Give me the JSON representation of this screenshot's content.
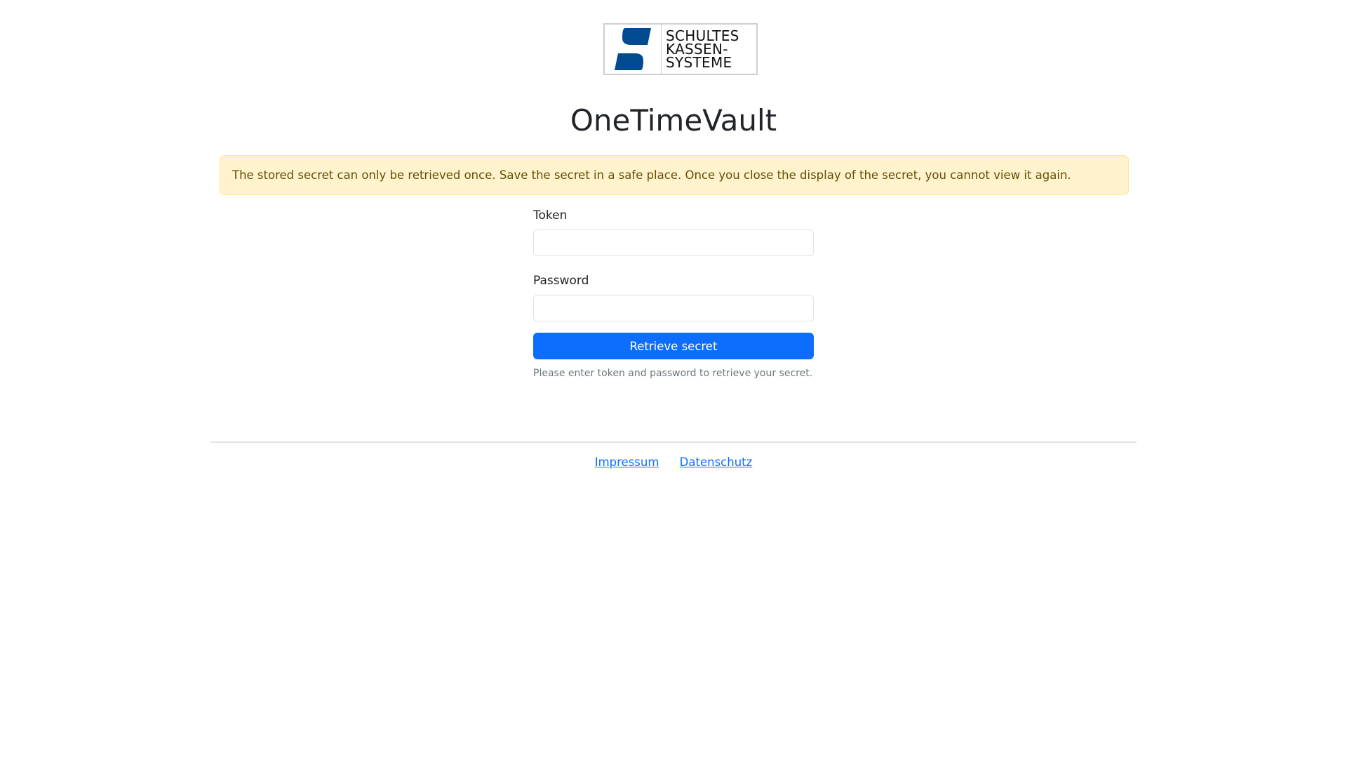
{
  "logo": {
    "line1": "SCHULTES",
    "line2": "KASSEN-",
    "line3": "SYSTEME",
    "mark_color": "#004a8f"
  },
  "page_title": "OneTimeVault",
  "alert": {
    "text": "The stored secret can only be retrieved once. Save the secret in a safe place. Once you close the display of the secret, you cannot view it again."
  },
  "form": {
    "token_label": "Token",
    "token_value": "",
    "password_label": "Password",
    "password_value": "",
    "submit_label": "Retrieve secret",
    "help_text": "Please enter token and password to retrieve your secret."
  },
  "footer": {
    "links": [
      "Impressum",
      "Datenschutz"
    ]
  },
  "colors": {
    "primary": "#0d6efd",
    "alert_bg": "#fff3cd",
    "alert_text": "#664d03"
  }
}
